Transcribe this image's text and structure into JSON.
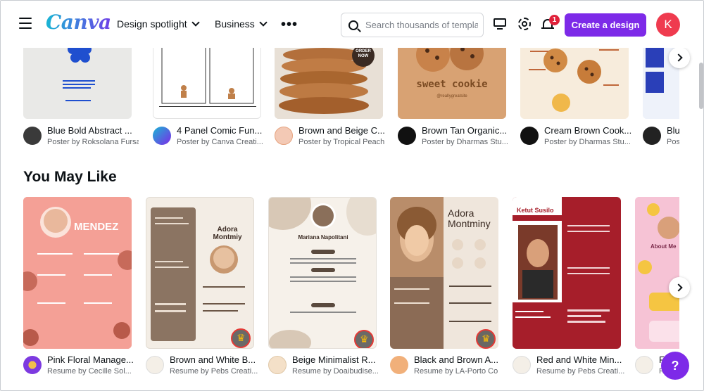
{
  "header": {
    "logo": "Canva",
    "nav": [
      "Design spotlight",
      "Business"
    ],
    "more": "•••",
    "search_placeholder": "Search thousands of templates",
    "notification_count": "1",
    "create_label": "Create a design",
    "avatar_letter": "K"
  },
  "top_row": [
    {
      "title": "Blue Bold Abstract ...",
      "by": "Poster by Roksolana Fursa",
      "bg": "#e9e9e7"
    },
    {
      "title": "4 Panel Comic Fun...",
      "by": "Poster by Canva Creati...",
      "bg": "#ffffff"
    },
    {
      "title": "Brown and Beige C...",
      "by": "Poster by Tropical Peach",
      "bg": "#c98a56",
      "badge": "ORDER NOW"
    },
    {
      "title": "Brown Tan Organic...",
      "by": "Poster by Dharmas Stu...",
      "bg": "#d8a273",
      "overlay": "sweet cookie",
      "handle": "@reallygreatsite"
    },
    {
      "title": "Cream Brown Cook...",
      "by": "Poster by Dharmas Stu...",
      "bg": "#f7ecdc"
    },
    {
      "title": "Blu",
      "by": "Post",
      "bg": "#e8eef8"
    }
  ],
  "section_title": "You May Like",
  "bottom_row": [
    {
      "title": "Pink Floral Manage...",
      "by": "Resume by Cecille Sol...",
      "bg": "#f59a8e",
      "name": "MENDEZ"
    },
    {
      "title": "Brown and White B...",
      "by": "Resume by Pebs Creati...",
      "bg": "#f3ede5",
      "name": "Adora Montmiy"
    },
    {
      "title": "Beige Minimalist R...",
      "by": "Resume by Doaibudise...",
      "bg": "#f6f1ea",
      "name": "Mariana Napolitani"
    },
    {
      "title": "Black and Brown A...",
      "by": "Resume by LA-Porto Co",
      "bg": "#efe6dc",
      "name": "Adora Montminy"
    },
    {
      "title": "Red and White Min...",
      "by": "Resume by Pebs Creati...",
      "bg": "#a61e2a",
      "name": "Ketut Susilo"
    },
    {
      "title": "F",
      "by": "R",
      "bg": "#f3a8c8",
      "name": "About Me"
    }
  ],
  "help_label": "?"
}
